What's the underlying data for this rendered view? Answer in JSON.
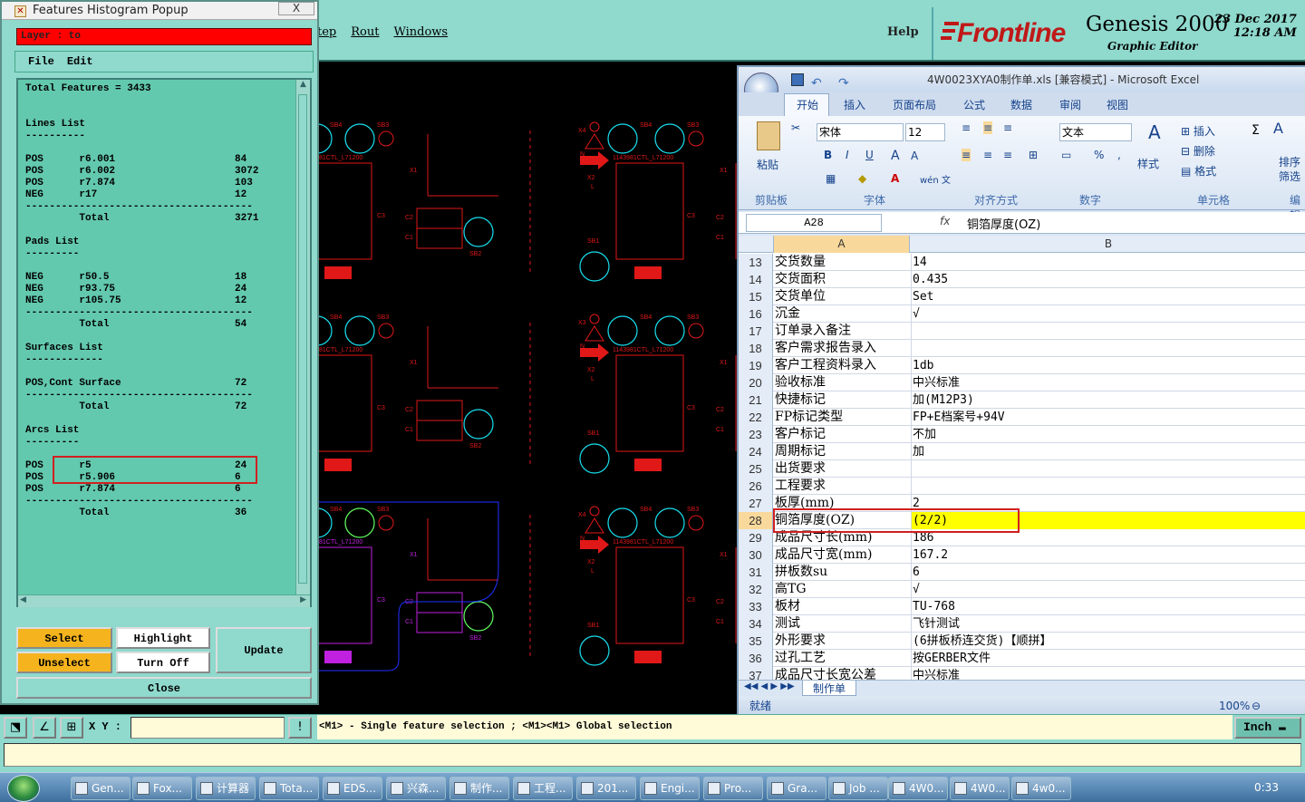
{
  "genesis": {
    "menu": [
      "tep",
      "Rout",
      "Windows"
    ],
    "help": "Help",
    "logo": "Frontline",
    "product": "Genesis 2000",
    "subtitle": "Graphic Editor",
    "date_line1": "23  Dec  2017",
    "date_line2": "12:18  AM"
  },
  "popup": {
    "title": "Features Histogram Popup",
    "close_icon": "X",
    "layer": "Layer :  to",
    "menu": [
      "File",
      "Edit"
    ],
    "list_text": "Total Features = 3433\n\n\nLines List\n----------\n\nPOS      r6.001                    84\nPOS      r6.002                    3072\nPOS      r7.874                    103\nNEG      r17                       12\n--------------------------------------\n         Total                     3271\n\nPads List\n---------\n\nNEG      r50.5                     18\nNEG      r93.75                    24\nNEG      r105.75                   12\n--------------------------------------\n         Total                     54\n\nSurfaces List\n-------------\n\nPOS,Cont Surface                   72\n--------------------------------------\n         Total                     72\n\nArcs List\n---------\n\nPOS      r5                        24\nPOS      r5.906                    6\nPOS      r7.874                    6\n--------------------------------------\n         Total                     36",
    "buttons": {
      "select": "Select",
      "highlight": "Highlight",
      "update": "Update",
      "unselect": "Unselect",
      "turn_off": "Turn Off",
      "close": "Close"
    }
  },
  "status": {
    "xy_label": "X Y :",
    "xy_value": "",
    "message": "<M1> - Single feature selection ; <M1><M1> Global selection",
    "unit": "Inch",
    "excl": "!"
  },
  "canvas_labels": {
    "sb4": "SB4",
    "sb3": "SB3",
    "sb2": "SB2",
    "sb1": "SB1",
    "x1": "X1",
    "x2": "X2",
    "x4": "X4",
    "x3": "X3",
    "c1": "C1",
    "c2": "C2",
    "c3": "C3",
    "n": "N",
    "l": "L",
    "ctl_a": "81CTL_L71200",
    "ctl_b": "1143981CTL_L71200"
  },
  "excel": {
    "title": "4W0023XYA0制作单.xls  [兼容模式]  -  Microsoft Excel",
    "tabs": [
      "开始",
      "插入",
      "页面布局",
      "公式",
      "数据",
      "审阅",
      "视图"
    ],
    "ribbon": {
      "paste": "粘贴",
      "font_name": "宋体",
      "font_size": "12",
      "number_format": "文本",
      "styles": "样式",
      "insert": "插入",
      "delete": "删除",
      "format": "格式",
      "sort": "排序",
      "filter": "筛选",
      "sigma": "Σ",
      "bold": "B",
      "italic": "I",
      "underline": "U",
      "percent": "%",
      "comma": ",",
      "wen": "wén 文",
      "groups": [
        "剪贴板",
        "字体",
        "对齐方式",
        "数字",
        "单元格",
        "编辑"
      ]
    },
    "name_box": "A28",
    "fx": "fx",
    "formula": "铜箔厚度(OZ)",
    "col_a": "A",
    "col_b": "B",
    "rows": [
      {
        "n": "13",
        "a": "交货数量",
        "b": "14"
      },
      {
        "n": "14",
        "a": "交货面积",
        "b": "0.435"
      },
      {
        "n": "15",
        "a": "交货单位",
        "b": "Set"
      },
      {
        "n": "16",
        "a": "沉金",
        "b": "√"
      },
      {
        "n": "17",
        "a": "订单录入备注",
        "b": ""
      },
      {
        "n": "18",
        "a": "客户需求报告录入",
        "b": ""
      },
      {
        "n": "19",
        "a": "客户工程资料录入",
        "b": "1db"
      },
      {
        "n": "20",
        "a": "验收标准",
        "b": "中兴标准"
      },
      {
        "n": "21",
        "a": "快捷标记",
        "b": "加(M12P3)"
      },
      {
        "n": "22",
        "a": "FP标记类型",
        "b": "FP+E档案号+94V"
      },
      {
        "n": "23",
        "a": "客户标记",
        "b": "不加"
      },
      {
        "n": "24",
        "a": "周期标记",
        "b": "加"
      },
      {
        "n": "25",
        "a": "出货要求",
        "b": ""
      },
      {
        "n": "26",
        "a": "工程要求",
        "b": ""
      },
      {
        "n": "27",
        "a": "板厚(mm)",
        "b": "2"
      },
      {
        "n": "28",
        "a": "铜箔厚度(OZ)",
        "b": " (2/2)"
      },
      {
        "n": "29",
        "a": "成品尺寸长(mm)",
        "b": "186"
      },
      {
        "n": "30",
        "a": "成品尺寸宽(mm)",
        "b": "167.2"
      },
      {
        "n": "31",
        "a": "拼板数su",
        "b": "6"
      },
      {
        "n": "32",
        "a": "高TG",
        "b": "√"
      },
      {
        "n": "33",
        "a": "板材",
        "b": "TU-768"
      },
      {
        "n": "34",
        "a": "测试",
        "b": "飞针测试"
      },
      {
        "n": "35",
        "a": "外形要求",
        "b": "(6拼板桥连交货)【顺拼】"
      },
      {
        "n": "36",
        "a": "过孔工艺",
        "b": "按GERBER文件"
      },
      {
        "n": "37",
        "a": "成品尺寸长宽公差",
        "b": "中兴标准"
      }
    ],
    "sheet_tab": "制作单",
    "status": "就绪",
    "zoom": "100%"
  },
  "taskbar": {
    "items": [
      "Gen...",
      "Fox...",
      "计算器",
      "Tota...",
      "EDS...",
      "兴森...",
      "制作...",
      "工程...",
      "201...",
      "Engi...",
      "Pro...",
      "Gra...",
      "Job ...",
      "4W0...",
      "4W0...",
      "4w0..."
    ],
    "clock": "0:33"
  },
  "colors": {
    "genesis_bg": "#8fd9cd",
    "list_bg": "#63c9ae",
    "layer_red": "#ff0000",
    "highlight_yellow": "#ffff00",
    "select_orange": "#f5b31e",
    "pcb_red": "#e01818",
    "pcb_cyan": "#18e0f0"
  }
}
